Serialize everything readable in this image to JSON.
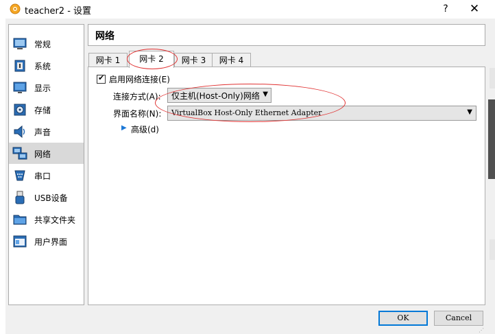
{
  "window": {
    "title": "teacher2 - 设置",
    "help": "?",
    "close": "✕"
  },
  "sidebar": {
    "items": [
      {
        "label": "常规",
        "icon": "general-icon"
      },
      {
        "label": "系统",
        "icon": "system-chip-icon"
      },
      {
        "label": "显示",
        "icon": "display-monitor-icon"
      },
      {
        "label": "存储",
        "icon": "storage-disk-icon"
      },
      {
        "label": "声音",
        "icon": "speaker-icon"
      },
      {
        "label": "网络",
        "icon": "network-icon",
        "selected": true
      },
      {
        "label": "串口",
        "icon": "serial-port-icon"
      },
      {
        "label": "USB设备",
        "icon": "usb-icon"
      },
      {
        "label": "共享文件夹",
        "icon": "folder-icon"
      },
      {
        "label": "用户界面",
        "icon": "user-interface-icon"
      }
    ]
  },
  "header": {
    "title": "网络"
  },
  "tabs": [
    {
      "label": "网卡 1",
      "active": false
    },
    {
      "label": "网卡 2",
      "active": true
    },
    {
      "label": "网卡 3",
      "active": false
    },
    {
      "label": "网卡 4",
      "active": false
    }
  ],
  "adapter": {
    "enable_label": "启用网络连接(E)",
    "enabled": true,
    "attached_label": "连接方式(A):",
    "attached_value": "仅主机(Host-Only)网络",
    "name_label": "界面名称(N):",
    "name_value": "VirtualBox Host-Only Ethernet Adapter",
    "advanced_label": "高级(d)"
  },
  "buttons": {
    "ok": "OK",
    "cancel": "Cancel"
  },
  "colors": {
    "annotation": "#e03030",
    "selected_bg": "#d9d9d9",
    "focus": "#0078d7"
  }
}
